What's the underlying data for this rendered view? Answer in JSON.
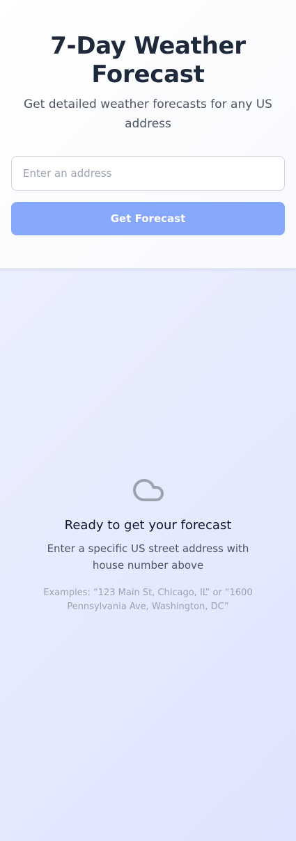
{
  "header": {
    "title": "7-Day Weather Forecast",
    "subtitle": "Get detailed weather forecasts for any US address"
  },
  "search": {
    "placeholder": "Enter an address",
    "value": "",
    "button_label": "Get Forecast"
  },
  "empty_state": {
    "icon": "cloud-icon",
    "title": "Ready to get your forecast",
    "description": "Enter a specific US street address with house number above",
    "examples": "Examples: “123 Main St, Chicago, IL” or “1600 Pennsylvania Ave, Washington, DC”"
  },
  "colors": {
    "title": "#1e293b",
    "button": "#86a8fb",
    "icon": "#9ca3af"
  }
}
